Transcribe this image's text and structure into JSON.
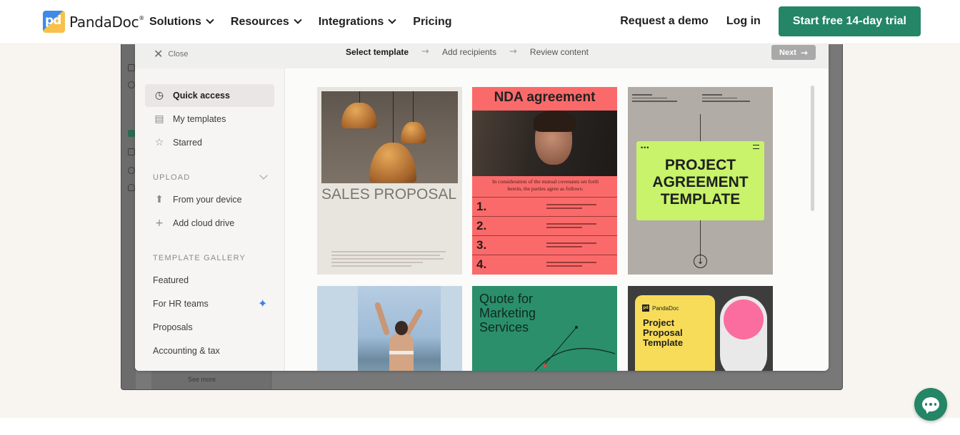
{
  "nav": {
    "brand": "PandaDoc",
    "brand_mark": "pd",
    "items": [
      "Solutions",
      "Resources",
      "Integrations",
      "Pricing"
    ],
    "request_demo": "Request a demo",
    "login": "Log in",
    "cta": "Start free 14-day trial"
  },
  "modal": {
    "close_label": "Close",
    "steps": [
      "Select template",
      "Add recipients",
      "Review content"
    ],
    "next_label": "Next",
    "sidebar": {
      "quick_access": "Quick access",
      "my_templates": "My templates",
      "starred": "Starred",
      "upload_header": "UPLOAD",
      "from_device": "From your device",
      "add_cloud": "Add cloud drive",
      "gallery_header": "TEMPLATE GALLERY",
      "gallery_items": [
        "Featured",
        "For HR teams",
        "Proposals",
        "Accounting & tax"
      ]
    },
    "templates": {
      "sales": "SALES PROPOSAL",
      "nda_title": "NDA agreement",
      "nda_lead": "In consideration of the mutual covenants set forth herein, the parties agree as follows:",
      "nda_numbers": [
        "1.",
        "2.",
        "3.",
        "4."
      ],
      "project": "PROJECT AGREEMENT TEMPLATE",
      "quote": "Quote for Marketing Services",
      "pp_brand": "PandaDoc",
      "pp_title": "Project Proposal Template"
    }
  },
  "background": {
    "see_more": "See more"
  },
  "colors": {
    "brand_green": "#248567",
    "nda_red": "#fb6a6a",
    "project_lime": "#c8f36a",
    "quote_green": "#2b8f6c",
    "proposal_yellow": "#f7dc5a"
  },
  "icons": [
    "clock-icon",
    "document-icon",
    "star-icon",
    "upload-icon",
    "plus-icon",
    "sparkle-icon",
    "close-icon",
    "arrow-right-icon",
    "chat-icon"
  ]
}
